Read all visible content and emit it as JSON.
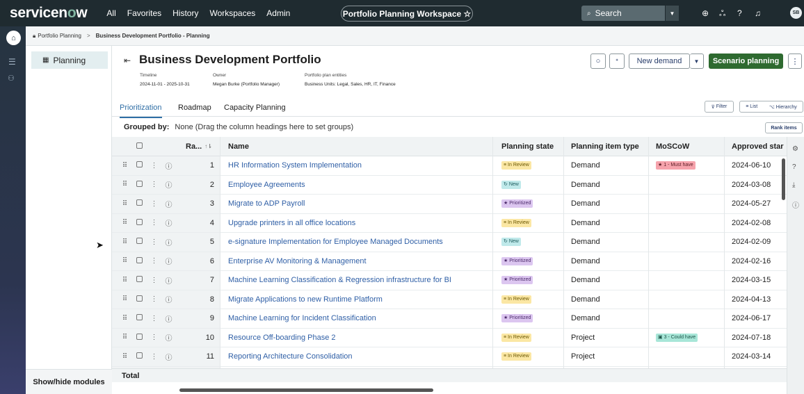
{
  "nav": {
    "logo": "servicenow",
    "items": [
      "All",
      "Favorites",
      "History",
      "Workspaces",
      "Admin"
    ],
    "workspace_pill": "Portfolio Planning Workspace ☆",
    "search_placeholder": "Search",
    "avatar": "SB"
  },
  "breadcrumb": {
    "root": "Portfolio Planning",
    "separator": ">",
    "current": "Business Development Portfolio - Planning"
  },
  "modules": {
    "item": "Planning",
    "show_hide": "Show/hide modules"
  },
  "header": {
    "title": "Business Development Portfolio",
    "timeline_label": "Timeline",
    "timeline_value": "2024-11-01 - 2025-10-31",
    "owner_label": "Owner",
    "owner_value": "Megan Burke (Portfolio Manager)",
    "entities_label": "Portfolio plan entities",
    "entities_value": "Business Units: Legal, Sales, HR, IT, Finance",
    "new_demand": "New demand",
    "scenario_planning": "Scenario planning"
  },
  "tabs": [
    "Prioritization",
    "Roadmap",
    "Capacity Planning"
  ],
  "toolbar": {
    "filter": "Filter",
    "list": "List",
    "hierarchy": "Hierarchy",
    "rank_items": "Rank items"
  },
  "grouped": {
    "label": "Grouped by:",
    "value": "None (Drag the column headings here to set groups)"
  },
  "columns": {
    "rank": "Ra...",
    "name": "Name",
    "planning_state": "Planning state",
    "item_type": "Planning item type",
    "moscow": "MoSCoW",
    "approved_start": "Approved star"
  },
  "rows": [
    {
      "rank": "1",
      "name": "HR Information System Implementation",
      "state": "In Review",
      "state_kind": "review",
      "type": "Demand",
      "moscow": "1 - Must have",
      "moscow_kind": "must",
      "date": "2024-06-10"
    },
    {
      "rank": "2",
      "name": "Employee Agreements",
      "state": "New",
      "state_kind": "new",
      "type": "Demand",
      "moscow": "",
      "moscow_kind": "",
      "date": "2024-03-08"
    },
    {
      "rank": "3",
      "name": "Migrate to ADP Payroll",
      "state": "Prioritized",
      "state_kind": "prior",
      "type": "Demand",
      "moscow": "",
      "moscow_kind": "",
      "date": "2024-05-27"
    },
    {
      "rank": "4",
      "name": "Upgrade printers in all office locations",
      "state": "In Review",
      "state_kind": "review",
      "type": "Demand",
      "moscow": "",
      "moscow_kind": "",
      "date": "2024-02-08"
    },
    {
      "rank": "5",
      "name": "e-signature Implementation for Employee Managed Documents",
      "state": "New",
      "state_kind": "new",
      "type": "Demand",
      "moscow": "",
      "moscow_kind": "",
      "date": "2024-02-09"
    },
    {
      "rank": "6",
      "name": "Enterprise AV Monitoring & Management",
      "state": "Prioritized",
      "state_kind": "prior",
      "type": "Demand",
      "moscow": "",
      "moscow_kind": "",
      "date": "2024-02-16"
    },
    {
      "rank": "7",
      "name": "Machine Learning Classification & Regression infrastructure for BI",
      "state": "Prioritized",
      "state_kind": "prior",
      "type": "Demand",
      "moscow": "",
      "moscow_kind": "",
      "date": "2024-03-15"
    },
    {
      "rank": "8",
      "name": "Migrate Applications to new Runtime Platform",
      "state": "In Review",
      "state_kind": "review",
      "type": "Demand",
      "moscow": "",
      "moscow_kind": "",
      "date": "2024-04-13"
    },
    {
      "rank": "9",
      "name": "Machine Learning for Incident Classification",
      "state": "Prioritized",
      "state_kind": "prior",
      "type": "Demand",
      "moscow": "",
      "moscow_kind": "",
      "date": "2024-06-17"
    },
    {
      "rank": "10",
      "name": "Resource Off-boarding Phase 2",
      "state": "In Review",
      "state_kind": "review",
      "type": "Project",
      "moscow": "3 - Could have",
      "moscow_kind": "could",
      "date": "2024-07-18"
    },
    {
      "rank": "11",
      "name": "Reporting Architecture Consolidation",
      "state": "In Review",
      "state_kind": "review",
      "type": "Project",
      "moscow": "",
      "moscow_kind": "",
      "date": "2024-03-14"
    }
  ],
  "total_label": "Total"
}
